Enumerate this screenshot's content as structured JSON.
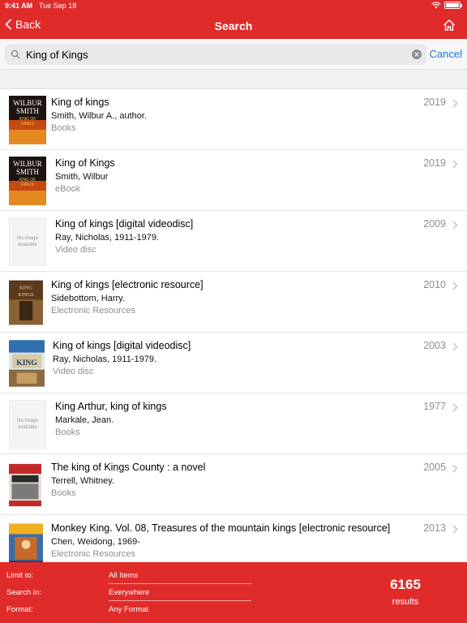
{
  "status": {
    "time": "9:41 AM",
    "date": "Tue Sep 18"
  },
  "nav": {
    "back_label": "Back",
    "title": "Search"
  },
  "search": {
    "value": "King of Kings",
    "cancel_label": "Cancel"
  },
  "results": [
    {
      "title": "King of kings",
      "author": "Smith, Wilbur A., author.",
      "format": "Books",
      "year": "2019",
      "cover": "wilbur"
    },
    {
      "title": "King of Kings",
      "author": "Smith, Wilbur",
      "format": "eBook",
      "year": "2019",
      "cover": "wilbur"
    },
    {
      "title": "King of kings [digital videodisc]",
      "author": "Ray, Nicholas, 1911-1979.",
      "format": "Video disc",
      "year": "2009",
      "cover": "none",
      "no_image_text": "No image available"
    },
    {
      "title": "King of kings [electronic resource]",
      "author": "Sidebottom, Harry.",
      "format": "Electronic Resources",
      "year": "2010",
      "cover": "kings-brown"
    },
    {
      "title": "King of kings [digital videodisc]",
      "author": "Ray, Nicholas, 1911-1979.",
      "format": "Video disc",
      "year": "2003",
      "cover": "kings-dvd"
    },
    {
      "title": "King Arthur, king of kings",
      "author": "Markale, Jean.",
      "format": "Books",
      "year": "1977",
      "cover": "none",
      "no_image_text": "No image available"
    },
    {
      "title": "The king of Kings County : a novel",
      "author": "Terrell, Whitney.",
      "format": "Books",
      "year": "2005",
      "cover": "kings-county"
    },
    {
      "title": "Monkey King. Vol. 08, Treasures of the mountain kings [electronic resource]",
      "author": "Chen, Weidong, 1969-",
      "format": "Electronic Resources",
      "year": "2013",
      "cover": "monkey"
    }
  ],
  "footer": {
    "limit_label": "Limit to:",
    "limit_value": "All Items",
    "search_in_label": "Search in:",
    "search_in_value": "Everywhere",
    "format_label": "Format:",
    "format_value": "Any Format",
    "count": "6165",
    "count_label": "results"
  },
  "colors": {
    "brand": "#e02b2b",
    "link": "#1a7ad6",
    "secondary_text": "#8e8e93"
  }
}
